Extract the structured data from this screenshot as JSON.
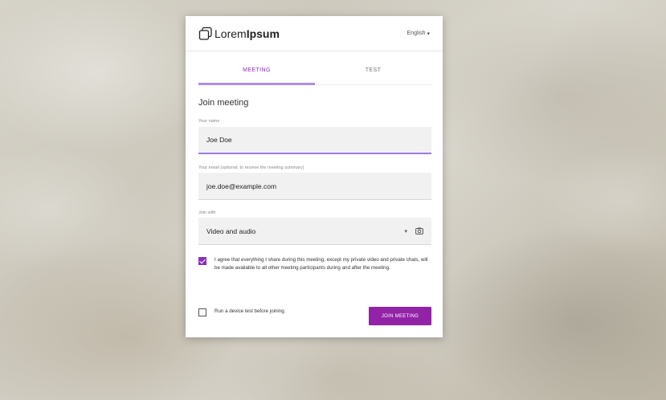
{
  "brand": {
    "name_light": "Lorem",
    "name_bold": "Ipsum",
    "logo_icon": "stacked-squares-logo"
  },
  "language": {
    "label": "English",
    "icon": "caret-down-icon"
  },
  "tabs": [
    {
      "label": "MEETING",
      "active": true
    },
    {
      "label": "TEST",
      "active": false
    }
  ],
  "form": {
    "title": "Join meeting",
    "name": {
      "label": "Your name",
      "value": "Joe Doe"
    },
    "email": {
      "label": "Your email (optional, to receive the meeting summary)",
      "value": "joe.doe@example.com"
    },
    "join_with": {
      "label": "Join with",
      "value": "Video and audio",
      "icons": [
        "caret-down-icon",
        "camera-settings-icon"
      ]
    },
    "consent": {
      "checked": true,
      "text": "I agree that everything I share during this meeting, except my private video and private chats, will be made available to all other meeting participants during and after the meeting."
    },
    "device_test": {
      "checked": false,
      "text": "Run a device test before joining."
    },
    "submit_label": "JOIN MEETING"
  },
  "colors": {
    "accent": "#9323a6",
    "tab_indicator": "#b18ee0",
    "field_bg": "#f1f1f1"
  }
}
